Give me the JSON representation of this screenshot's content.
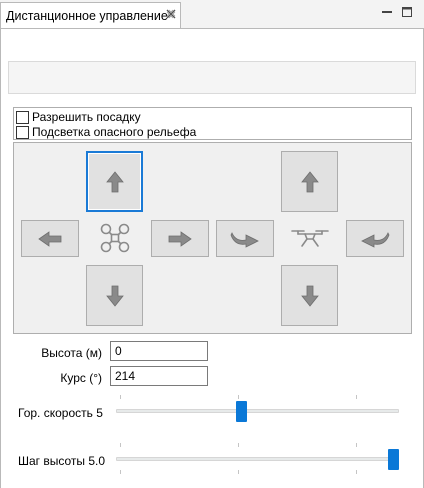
{
  "tab": {
    "title": "Дистанционное управление",
    "close_icon": "close-icon"
  },
  "window_controls": [
    "minimize-icon",
    "maximize-icon"
  ],
  "options": {
    "allow_landing_label": "Разрешить посадку",
    "allow_landing_checked": false,
    "terrain_highlight_label": "Подсветка опасного рельефа",
    "terrain_highlight_checked": false
  },
  "controls": {
    "left_pad": {
      "up_icon": "arrow-up-icon",
      "down_icon": "arrow-down-icon",
      "left_icon": "arrow-left-icon",
      "right_icon": "arrow-right-icon",
      "center_icon": "quadcopter-icon"
    },
    "right_pad": {
      "up_icon": "arrow-up-icon",
      "down_icon": "arrow-down-icon",
      "rotate_cw_icon": "rotate-right-icon",
      "rotate_ccw_icon": "rotate-left-icon",
      "center_icon": "drone-side-icon"
    }
  },
  "altitude": {
    "label": "Высота (м)",
    "value": "0"
  },
  "heading": {
    "label": "Курс (°)",
    "value": "214"
  },
  "sliders": {
    "horizontal_speed": {
      "label": "Гор. скорость 5",
      "level_fraction": 0.44
    },
    "altitude_step": {
      "label": "Шаг высоты 5.0",
      "level_fraction": 1.0
    }
  },
  "colors": {
    "accent": "#0a78d7",
    "button_face": "#e1e1e1",
    "arrow_fill": "#8a8a8a"
  }
}
